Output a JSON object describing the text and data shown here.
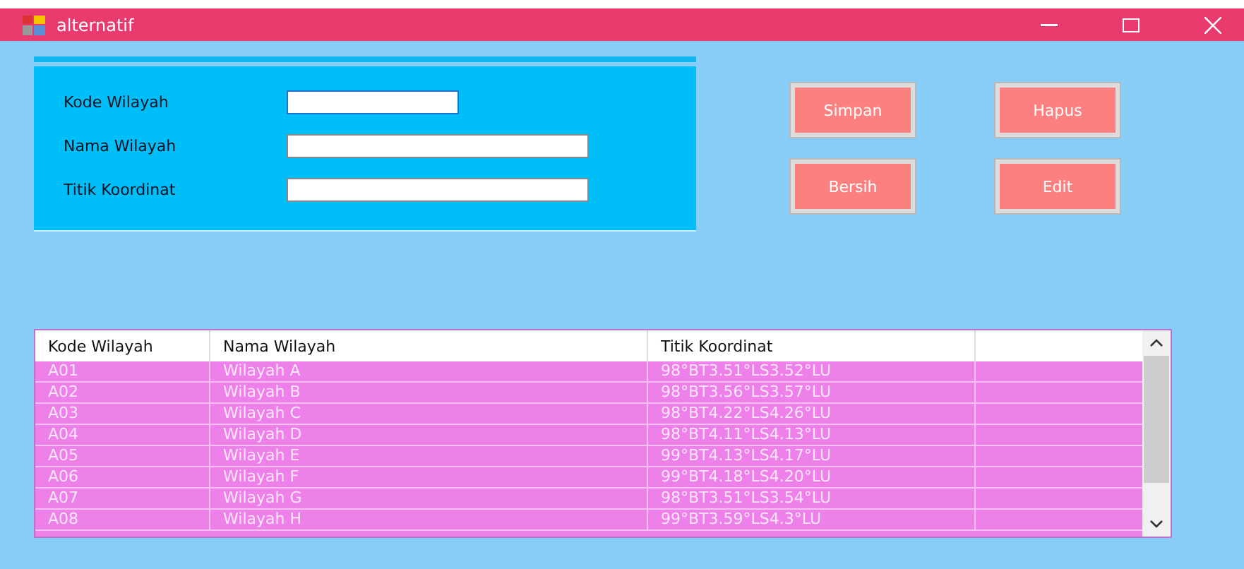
{
  "window": {
    "title": "alternatif"
  },
  "form": {
    "fields": [
      {
        "label": "Kode Wilayah",
        "focused": true
      },
      {
        "label": "Nama Wilayah",
        "focused": false
      },
      {
        "label": "Titik Koordinat",
        "focused": false
      }
    ]
  },
  "buttons": [
    [
      "Simpan",
      "Hapus"
    ],
    [
      "Bersih",
      "Edit"
    ]
  ],
  "table": {
    "columns": [
      "Kode Wilayah",
      "Nama Wilayah",
      "Titik Koordinat"
    ],
    "rows": [
      {
        "cells": [
          "A01",
          "Wilayah A",
          "98°BT3.51°LS3.52°LU"
        ],
        "selected": true
      },
      {
        "cells": [
          "A02",
          "Wilayah B",
          "98°BT3.56°LS3.57°LU"
        ],
        "selected": true
      },
      {
        "cells": [
          "A03",
          "Wilayah C",
          "98°BT4.22°LS4.26°LU"
        ],
        "selected": true
      },
      {
        "cells": [
          "A04",
          "Wilayah D",
          "98°BT4.11°LS4.13°LU"
        ],
        "selected": true
      },
      {
        "cells": [
          "A05",
          "Wilayah E",
          "99°BT4.13°LS4.17°LU"
        ],
        "selected": true
      },
      {
        "cells": [
          "A06",
          "Wilayah F",
          "99°BT4.18°LS4.20°LU"
        ],
        "selected": true
      },
      {
        "cells": [
          "A07",
          "Wilayah G",
          "98°BT3.51°LS3.54°LU"
        ],
        "selected": true
      },
      {
        "cells": [
          "A08",
          "Wilayah H",
          "99°BT3.59°LS4.3°LU"
        ],
        "selected": true
      }
    ]
  }
}
